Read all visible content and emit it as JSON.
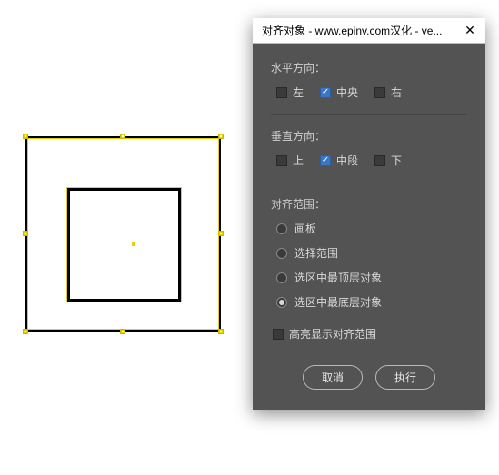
{
  "dialog": {
    "title": "对齐对象 - www.epinv.com汉化 - ve...",
    "horizontal": {
      "label": "水平方向：",
      "options": {
        "left": "左",
        "center": "中央",
        "right": "右"
      },
      "selected": "center"
    },
    "vertical": {
      "label": "垂直方向：",
      "options": {
        "top": "上",
        "middle": "中段",
        "bottom": "下"
      },
      "selected": "middle"
    },
    "scope": {
      "label": "对齐范围：",
      "options": {
        "artboard": "画板",
        "selection": "选择范围",
        "topmost": "选区中最顶层对象",
        "bottommost": "选区中最底层对象"
      },
      "selected": "bottommost"
    },
    "highlight_label": "高亮显示对齐范围",
    "highlight_checked": false,
    "buttons": {
      "cancel": "取消",
      "execute": "执行"
    }
  }
}
